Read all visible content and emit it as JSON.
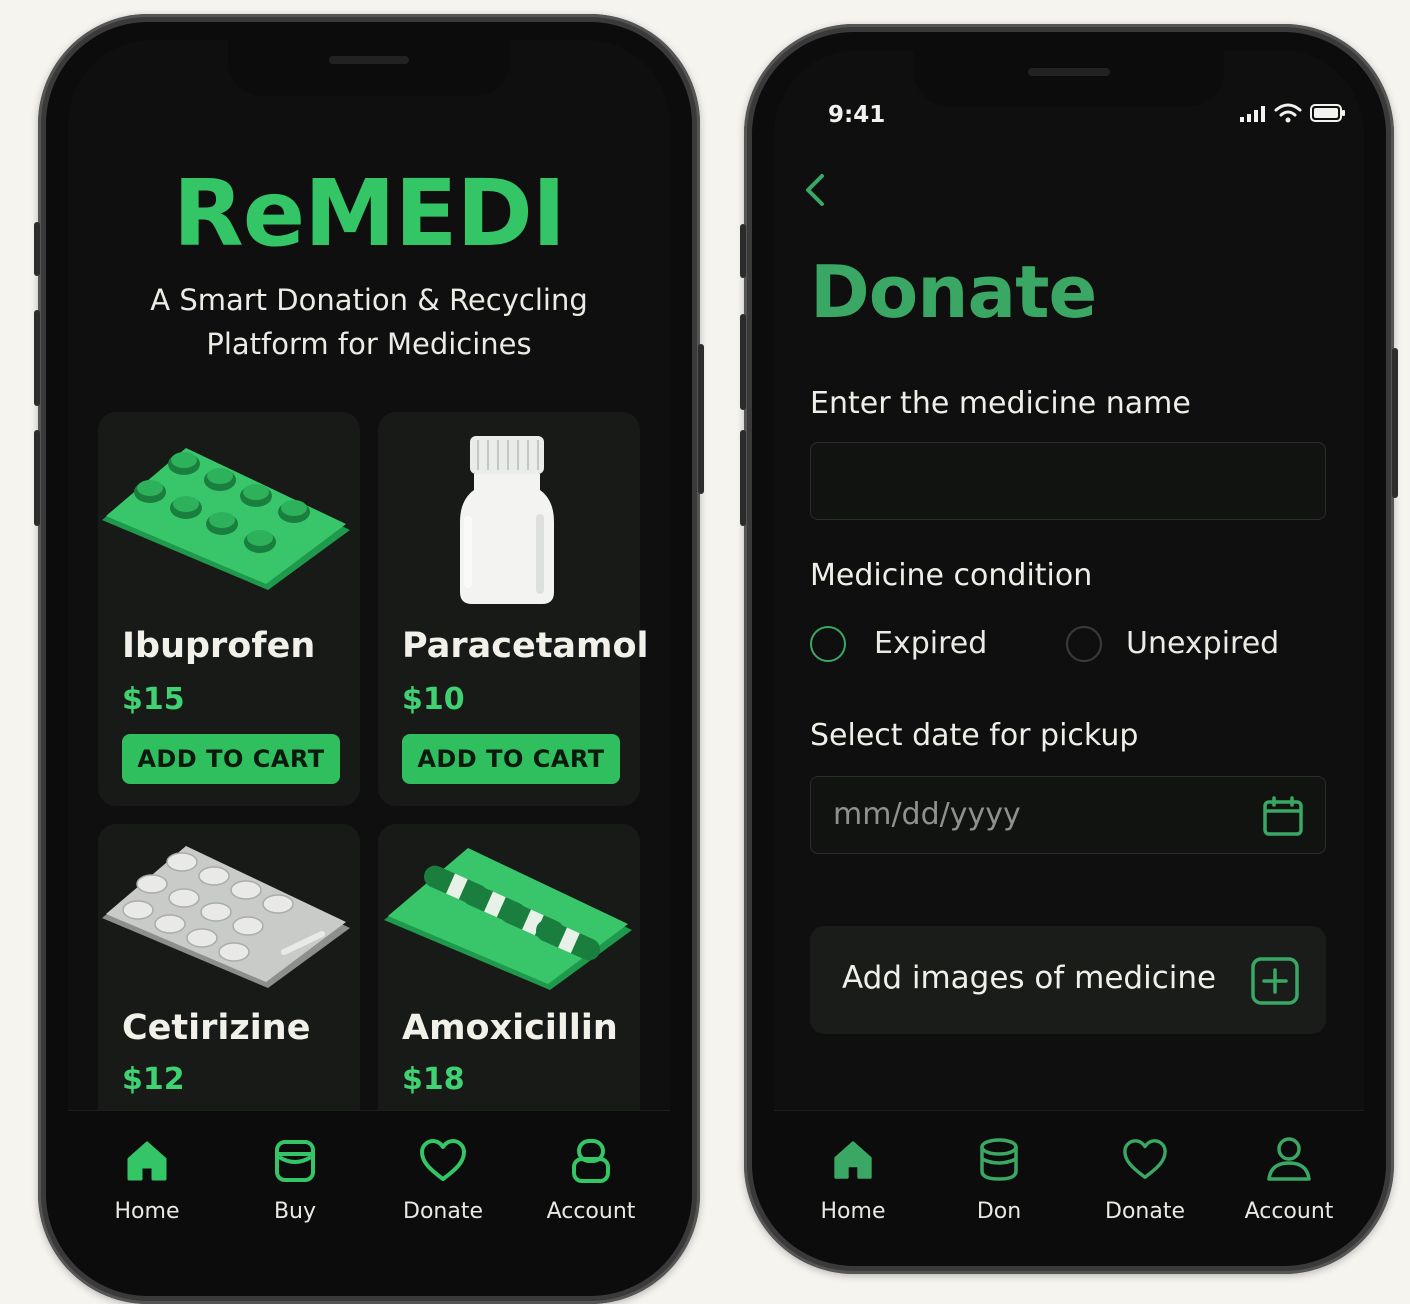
{
  "left_screen": {
    "brand": "ReMEDI",
    "tagline_line1": "A Smart Donation & Recycling",
    "tagline_line2": "Platform for Medicines",
    "products": [
      {
        "name": "Ibuprofen",
        "price": "$15",
        "button": "ADD TO CART"
      },
      {
        "name": "Paracetamol",
        "price": "$10",
        "button": "ADD TO CART"
      },
      {
        "name": "Cetirizine",
        "price": "$12"
      },
      {
        "name": "Amoxicillin",
        "price": "$18"
      }
    ],
    "tabs": [
      {
        "label": "Home",
        "icon": "home-icon"
      },
      {
        "label": "Buy",
        "icon": "box-icon"
      },
      {
        "label": "Donate",
        "icon": "heart-icon"
      },
      {
        "label": "Account",
        "icon": "account-icon"
      }
    ]
  },
  "right_screen": {
    "status_time": "9:41",
    "title": "Donate",
    "medicine_name_label": "Enter the medicine name",
    "condition_label": "Medicine condition",
    "condition_options": [
      "Expired",
      "Unexpired"
    ],
    "pickup_label": "Select date for pickup",
    "date_placeholder": "mm/dd/yyyy",
    "add_images_label": "Add images of medicine",
    "tabs": [
      {
        "label": "Home",
        "icon": "home-icon"
      },
      {
        "label": "Don",
        "icon": "cylinder-icon"
      },
      {
        "label": "Donate",
        "icon": "heart-icon"
      },
      {
        "label": "Account",
        "icon": "person-icon"
      }
    ]
  },
  "colors": {
    "accent": "#34c567",
    "accent_dark": "#3aa864",
    "background": "#0e0f0e",
    "card": "#171a17"
  }
}
